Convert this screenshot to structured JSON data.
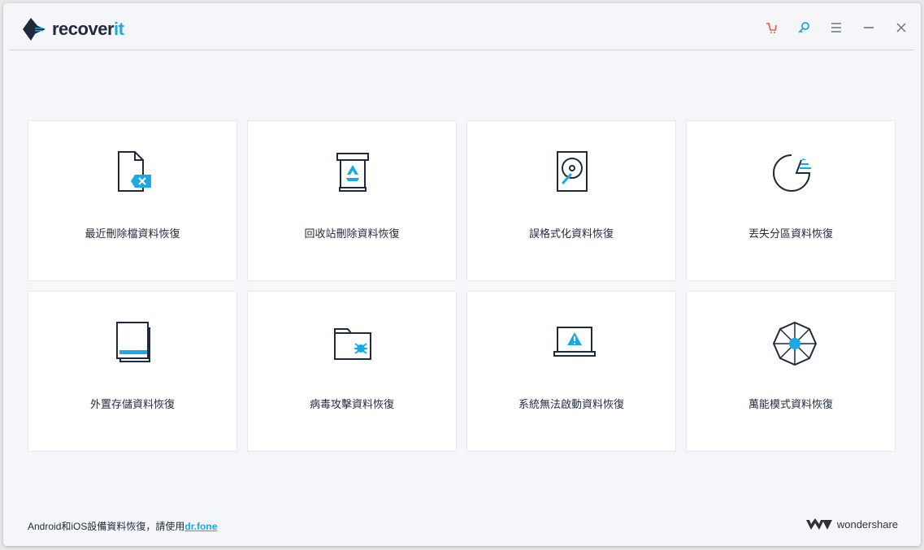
{
  "app": {
    "logo_main": "recover",
    "logo_accent": "it"
  },
  "header": {
    "icons": [
      "cart-icon",
      "key-icon",
      "menu-icon",
      "minimize-icon",
      "close-icon"
    ]
  },
  "colors": {
    "accent": "#1aa9e4",
    "dark": "#1f2a3d",
    "cart": "#f0563a"
  },
  "cards": [
    {
      "label": "最近刪除檔資料恢復",
      "icon": "deleted-file-icon"
    },
    {
      "label": "回收站刪除資料恢復",
      "icon": "recycle-bin-icon"
    },
    {
      "label": "誤格式化資料恢復",
      "icon": "hard-drive-icon"
    },
    {
      "label": "丟失分區資料恢復",
      "icon": "partition-icon"
    },
    {
      "label": "外置存儲資料恢復",
      "icon": "external-device-icon"
    },
    {
      "label": "病毒攻擊資料恢復",
      "icon": "virus-folder-icon"
    },
    {
      "label": "系統無法啟動資料恢復",
      "icon": "system-crash-icon"
    },
    {
      "label": "萬能模式資料恢復",
      "icon": "all-around-icon"
    }
  ],
  "footer": {
    "text": "Android和iOS設備資料恢復，請使用",
    "link": "dr.fone",
    "brand": "wondershare"
  }
}
